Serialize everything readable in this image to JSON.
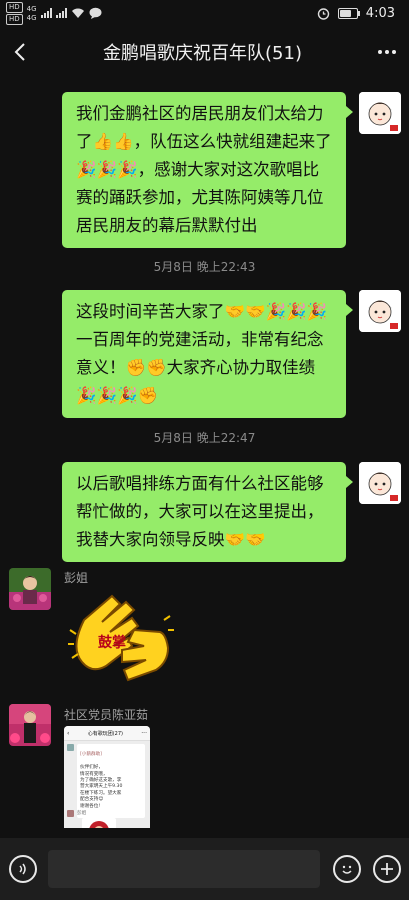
{
  "status_bar": {
    "left_items": [
      "HD",
      "4G",
      "HD",
      "4G"
    ],
    "time": "4:03"
  },
  "header": {
    "title": "金鹏唱歌庆祝百年队(51)",
    "back_icon": "chevron-left-icon",
    "more_icon": "more-dots-icon"
  },
  "messages": [
    {
      "side": "right",
      "text": "我们金鹏社区的居民朋友们太给力了👍👍，队伍这么快就组建起来了🎉🎉🎉，感谢大家对这次歌唱比赛的踊跃参加，尤其陈阿姨等几位居民朋友的幕后默默付出"
    },
    {
      "time": "5月8日 晚上22:43"
    },
    {
      "side": "right",
      "text": "这段时间辛苦大家了🤝🤝🎉🎉🎉一百周年的党建活动，非常有纪念意义！✊✊大家齐心协力取佳绩🎉🎉🎉✊"
    },
    {
      "time": "5月8日 晚上22:47"
    },
    {
      "side": "right",
      "text": "以后歌唱排练方面有什么社区能够帮忙做的，大家可以在这里提出，我替大家向领导反映🤝🤝"
    },
    {
      "side": "left",
      "sender": "彭姐",
      "sticker_text": "鼓掌"
    },
    {
      "side": "left",
      "sender": "社区党员陈亚茹",
      "screenshot": {
        "group_title": "心有歌玩团(27)",
        "notice_head": "[小鹅群助]",
        "notice_body": "伙伴们好，\n情况有变哦，\n为了确好这支歌，李\n营大家明天上午9.30\n在楼下练习。望大家\n配合支持😊\n谢谢各位!",
        "reply_sender": "彭姐"
      }
    }
  ],
  "bottom": {
    "voice_icon": "voice-icon",
    "emoji_icon": "emoji-icon",
    "plus_icon": "plus-icon",
    "input_value": ""
  },
  "colors": {
    "bubble": "#95ec69",
    "background": "#111111",
    "bottom_bar": "#1e1e1e"
  }
}
